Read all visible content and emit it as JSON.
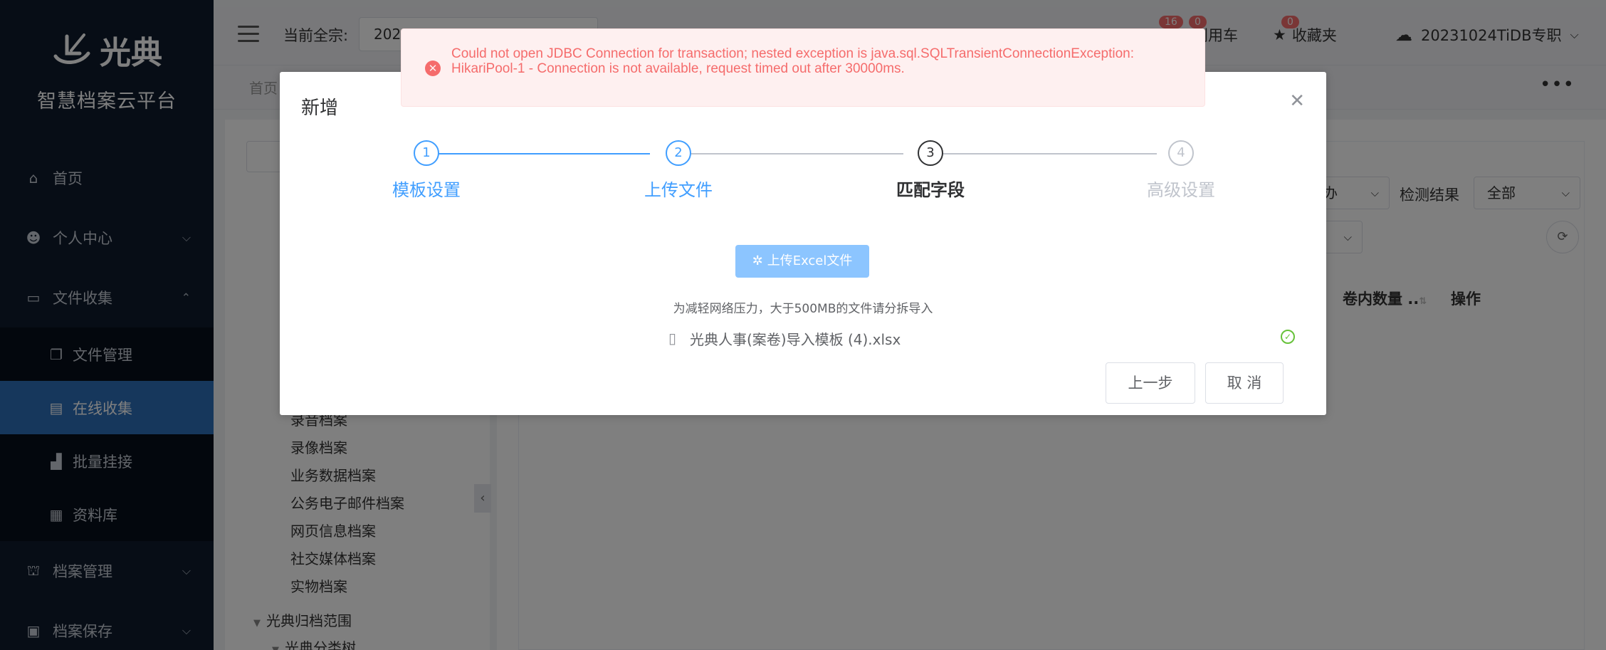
{
  "sidebar": {
    "logo_text": "光典",
    "platform_name": "智慧档案云平台",
    "menu": [
      {
        "label": "首页",
        "icon": "home-icon"
      },
      {
        "label": "个人中心",
        "icon": "user-icon"
      },
      {
        "label": "文件收集",
        "icon": "folder-icon"
      }
    ],
    "submenu": [
      {
        "label": "文件管理",
        "icon": "files-icon"
      },
      {
        "label": "在线收集",
        "icon": "document-icon"
      },
      {
        "label": "批量挂接",
        "icon": "chart-icon"
      },
      {
        "label": "资料库",
        "icon": "calendar-icon"
      }
    ],
    "menu_bottom": [
      {
        "label": "档案管理",
        "icon": "bank-icon"
      },
      {
        "label": "档案保存",
        "icon": "building-icon"
      }
    ]
  },
  "header": {
    "current_fonds_label": "当前全宗:",
    "current_fonds_value": "202",
    "use_car_label": "利用车",
    "use_car_count": "0",
    "notice_count": "16",
    "favorites_label": "收藏夹",
    "favorites_count": "0",
    "account_name": "20231024TiDB专职"
  },
  "tabs": {
    "home": "首页",
    "more": "•••"
  },
  "tree": {
    "items": [
      "录音档案",
      "录像档案",
      "业务数据档案",
      "公务电子邮件档案",
      "网页信息档案",
      "社交媒体档案",
      "实物档案"
    ],
    "group": "光典归档范围",
    "subgroup": "光典分类树",
    "collapse_glyph": "‹"
  },
  "main": {
    "detect_result_label": "检测结果",
    "detect_result_value": "全部",
    "status_partial": "办",
    "col_volume_count": "卷内数量 ..",
    "col_actions": "操作"
  },
  "modal": {
    "title": "新增",
    "steps": [
      {
        "number": "1",
        "label": "模板设置",
        "state": "done"
      },
      {
        "number": "2",
        "label": "上传文件",
        "state": "done"
      },
      {
        "number": "3",
        "label": "匹配字段",
        "state": "active"
      },
      {
        "number": "4",
        "label": "高级设置",
        "state": "pending"
      }
    ],
    "upload_button": "上传Excel文件",
    "upload_tip": "为减轻网络压力，大于500MB的文件请分拆导入",
    "file_name": "光典人事(案卷)导入模板 (4).xlsx",
    "prev_button": "上一步",
    "cancel_button": "取 消"
  },
  "error": {
    "message": "Could not open JDBC Connection for transaction; nested exception is java.sql.SQLTransientConnectionException: HikariPool-1 - Connection is not available, request timed out after 30000ms."
  },
  "colors": {
    "primary": "#409eff",
    "sidebar": "#0f1b2d",
    "active_menu": "#2c6fb8",
    "error": "#f56c6c",
    "success": "#67c23a"
  }
}
